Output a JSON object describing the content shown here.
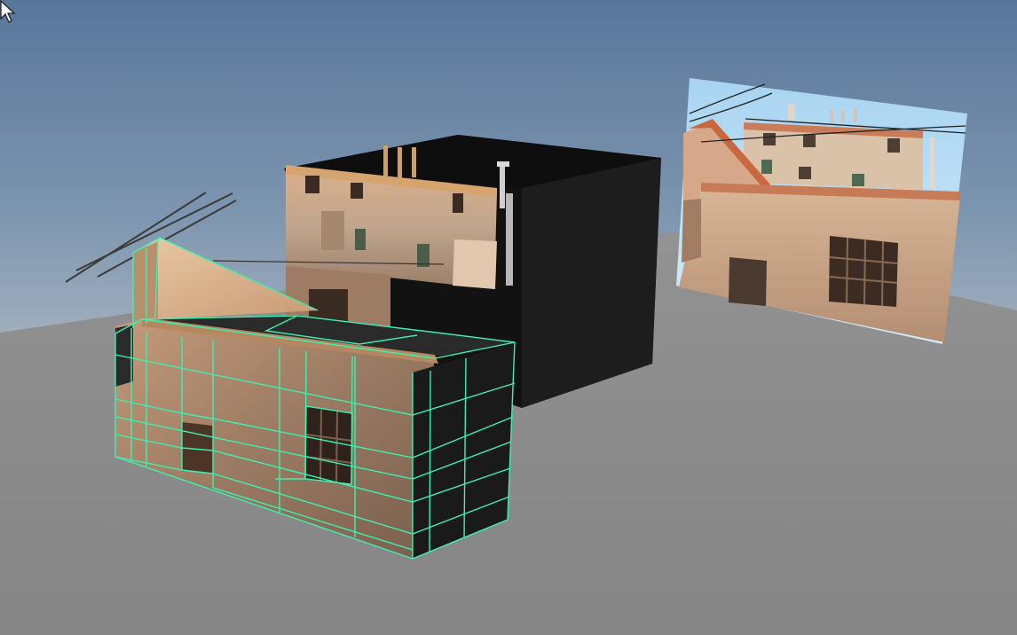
{
  "viewport": {
    "background_top_color": "#5b7898",
    "background_horizon_color": "#9fb0c0",
    "ground_color": "#8c8c8c",
    "wireframe_color": "#3ef0b0"
  },
  "objects": [
    {
      "name": "selected-house-mesh",
      "selected": true
    },
    {
      "name": "textured-box",
      "selected": false
    },
    {
      "name": "reference-image-plane",
      "selected": false
    }
  ],
  "cursor": {
    "icon": "arrow-cursor-icon"
  }
}
